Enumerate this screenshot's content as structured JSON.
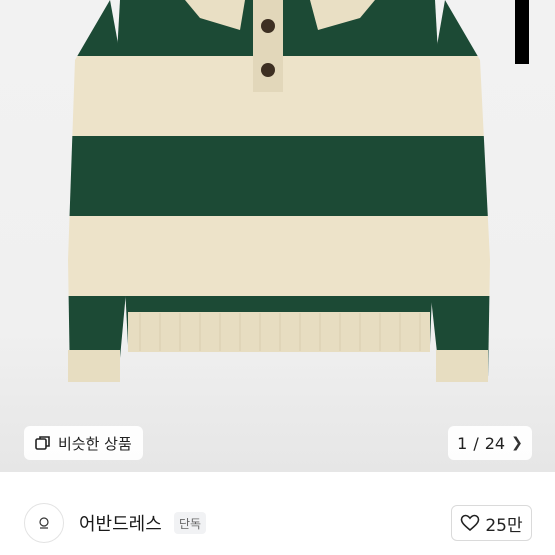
{
  "product_image": {
    "alt": "",
    "stripe_colors": {
      "cream": "#ede3c9",
      "green": "#1c4a35"
    },
    "similar_button": {
      "label": "비슷한 상품",
      "icon": "similar-products-icon"
    },
    "pagination": {
      "current": "1",
      "separator": "/",
      "total": "24",
      "next_icon": "chevron-right-icon"
    }
  },
  "seller": {
    "name": "어반드레스",
    "badge": "단독",
    "like": {
      "icon": "heart-outline-icon",
      "count": "25만"
    }
  }
}
